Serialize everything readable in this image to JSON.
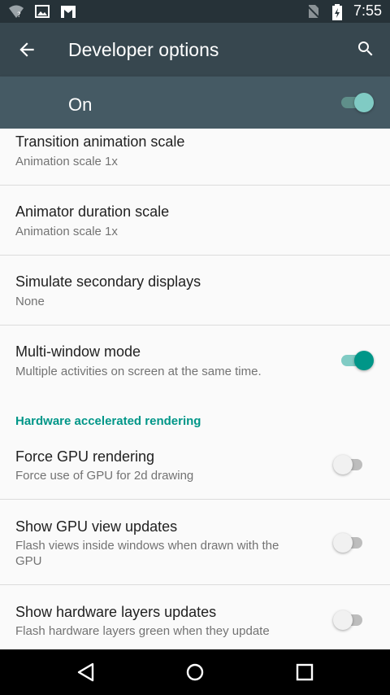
{
  "status_bar": {
    "time": "7:55",
    "icons": [
      "wifi-question-icon",
      "image-icon",
      "gmail-icon",
      "no-sim-icon",
      "battery-charging-icon"
    ]
  },
  "toolbar": {
    "title": "Developer options",
    "back_icon": "arrow-back-icon",
    "search_icon": "search-icon"
  },
  "master_switch": {
    "label": "On",
    "state": "on"
  },
  "settings": [
    {
      "title": "Transition animation scale",
      "summary": "Animation scale 1x"
    },
    {
      "title": "Animator duration scale",
      "summary": "Animation scale 1x"
    },
    {
      "title": "Simulate secondary displays",
      "summary": "None"
    },
    {
      "title": "Multi-window mode",
      "summary": "Multiple activities on screen at the same time.",
      "toggle": "on"
    }
  ],
  "section_header": "Hardware accelerated rendering",
  "rendering_settings": [
    {
      "title": "Force GPU rendering",
      "summary": "Force use of GPU for 2d drawing",
      "toggle": "off"
    },
    {
      "title": "Show GPU view updates",
      "summary_line1": "Flash views inside windows when drawn with the",
      "summary_line2": "GPU",
      "toggle": "off"
    },
    {
      "title": "Show hardware layers updates",
      "summary": "Flash hardware layers green when they update",
      "toggle": "off"
    }
  ],
  "nav_bar": {
    "buttons": [
      "back-triangle-icon",
      "home-circle-icon",
      "recents-square-icon"
    ]
  },
  "colors": {
    "status_bar": "#263238",
    "toolbar": "#37474f",
    "master_bar": "#455a64",
    "accent": "#009688"
  }
}
